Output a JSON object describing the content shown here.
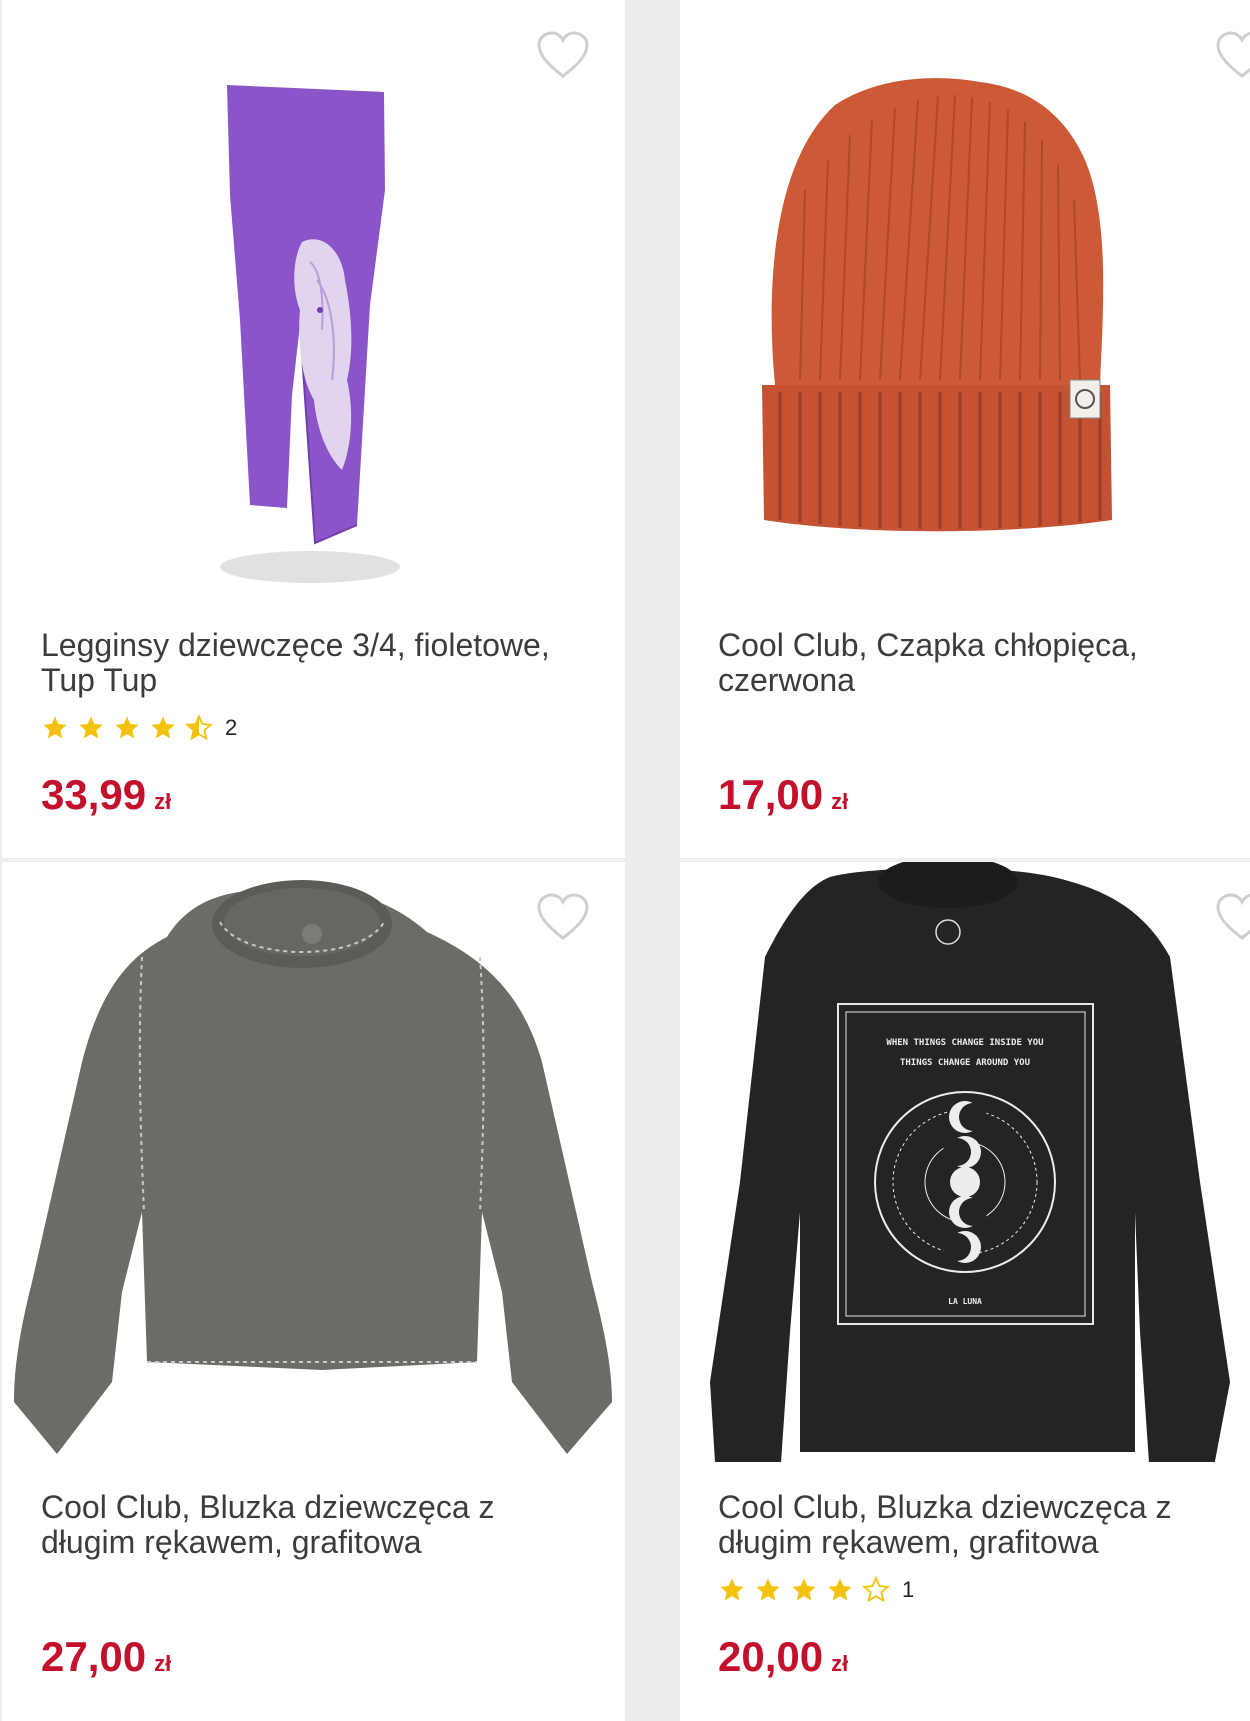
{
  "products": [
    {
      "title": "Legginsy dziewczęce 3/4, fioletowe, Tup Tup",
      "rating": 4.5,
      "rating_count": "2",
      "price": "33,99",
      "currency": "zł",
      "color": "#8b55c9"
    },
    {
      "title": "Cool Club, Czapka chłopięca, czerwona",
      "price": "17,00",
      "currency": "zł",
      "color": "#cc5a36"
    },
    {
      "title": "Cool Club, Bluzka dziewczęca z długim rękawem, grafitowa",
      "price": "27,00",
      "currency": "zł",
      "color": "#6c6b68"
    },
    {
      "title": "Cool Club, Bluzka dziewczęca z długim rękawem, grafitowa",
      "rating": 4,
      "rating_count": "1",
      "price": "20,00",
      "currency": "zł",
      "color": "#232426",
      "print_text": [
        "WHEN THINGS CHANGE INSIDE YOU",
        "THINGS CHANGE AROUND YOU",
        "LA LUNA"
      ]
    }
  ],
  "colors": {
    "price": "#c3102c",
    "star": "#f4c20d",
    "heart": "#cfcfcf",
    "divider": "#ededed"
  },
  "icons": {
    "wishlist": "heart-outline-icon",
    "rating": "star-icon"
  }
}
